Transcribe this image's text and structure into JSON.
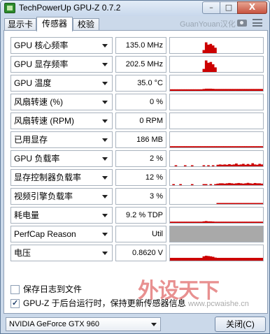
{
  "window": {
    "title": "TechPowerUp GPU-Z 0.7.2",
    "close_glyph": "X"
  },
  "tabs": [
    {
      "label": "显示卡"
    },
    {
      "label": "传感器",
      "active": true
    },
    {
      "label": "校验"
    }
  ],
  "brand_text": "GuanYouan汉化",
  "sensors": [
    {
      "label": "GPU 核心频率",
      "value": "135.0 MHz",
      "trace": [
        0,
        0,
        0,
        0,
        0,
        0,
        0,
        0,
        0,
        0,
        0,
        0,
        0,
        0,
        0.2,
        0.7,
        0.55,
        0.6,
        0.5,
        0.35,
        0,
        0,
        0,
        0,
        0,
        0,
        0,
        0,
        0,
        0,
        0,
        0,
        0,
        0,
        0,
        0,
        0,
        0,
        0,
        0
      ]
    },
    {
      "label": "GPU 显存频率",
      "value": "202.5 MHz",
      "trace": [
        0,
        0,
        0,
        0,
        0,
        0,
        0,
        0,
        0,
        0,
        0,
        0,
        0,
        0,
        0.2,
        0.75,
        0.6,
        0.65,
        0.5,
        0.3,
        0,
        0,
        0,
        0,
        0,
        0,
        0,
        0,
        0,
        0,
        0,
        0,
        0,
        0,
        0,
        0,
        0,
        0,
        0,
        0
      ]
    },
    {
      "label": "GPU 温度",
      "value": "35.0 °C",
      "trace": [
        0.1,
        0.1,
        0.1,
        0.1,
        0.1,
        0.1,
        0.1,
        0.1,
        0.1,
        0.1,
        0.1,
        0.1,
        0.1,
        0.1,
        0.12,
        0.14,
        0.14,
        0.14,
        0.13,
        0.12,
        0.12,
        0.12,
        0.12,
        0.12,
        0.12,
        0.12,
        0.12,
        0.12,
        0.12,
        0.12,
        0.12,
        0.12,
        0.12,
        0.12,
        0.12,
        0.12,
        0.12,
        0.12,
        0.12,
        0.12
      ]
    },
    {
      "label": "风扇转速 (%)",
      "value": "0 %",
      "trace": []
    },
    {
      "label": "风扇转速 (RPM)",
      "value": "0 RPM",
      "trace": []
    },
    {
      "label": "已用显存",
      "value": "186 MB",
      "trace": [
        0.08,
        0.08,
        0.08,
        0.08,
        0.08,
        0.08,
        0.08,
        0.08,
        0.08,
        0.08,
        0.08,
        0.08,
        0.08,
        0.08,
        0.08,
        0.08,
        0.08,
        0.08,
        0.08,
        0.08,
        0.08,
        0.08,
        0.08,
        0.08,
        0.08,
        0.08,
        0.08,
        0.08,
        0.08,
        0.08,
        0.08,
        0.08,
        0.08,
        0.08,
        0.08,
        0.08,
        0.08,
        0.08,
        0.08,
        0.08
      ]
    },
    {
      "label": "GPU 负载率",
      "value": "2 %",
      "trace": [
        0,
        0,
        0.05,
        0,
        0,
        0,
        0.04,
        0,
        0,
        0.05,
        0,
        0,
        0,
        0,
        0.05,
        0,
        0.04,
        0,
        0.05,
        0,
        0.1,
        0.12,
        0.1,
        0.12,
        0.1,
        0.14,
        0.1,
        0.12,
        0.18,
        0.1,
        0.12,
        0.16,
        0.1,
        0.15,
        0.1,
        0.2,
        0.12,
        0.1,
        0.16,
        0.12
      ]
    },
    {
      "label": "显存控制器负载率",
      "value": "12 %",
      "trace": [
        0,
        0.03,
        0,
        0,
        0.03,
        0,
        0,
        0,
        0,
        0.03,
        0,
        0,
        0,
        0,
        0.03,
        0.05,
        0,
        0.03,
        0,
        0.05,
        0.1,
        0.12,
        0.12,
        0.1,
        0.12,
        0.14,
        0.12,
        0.1,
        0.12,
        0.14,
        0.12,
        0.1,
        0.12,
        0.15,
        0.12,
        0.1,
        0.14,
        0.12,
        0.12,
        0.1
      ]
    },
    {
      "label": "视频引擎负载率",
      "value": "3 %",
      "trace": [
        0,
        0,
        0,
        0,
        0,
        0,
        0,
        0,
        0,
        0,
        0,
        0,
        0,
        0,
        0,
        0,
        0,
        0,
        0,
        0,
        0.06,
        0.06,
        0.06,
        0.06,
        0.06,
        0.06,
        0.06,
        0.06,
        0.06,
        0.06,
        0.06,
        0.06,
        0.06,
        0.06,
        0.06,
        0.06,
        0.06,
        0.06,
        0.06,
        0.06
      ]
    },
    {
      "label": "耗电量",
      "value": "9.2 % TDP",
      "trace": [
        0.08,
        0.08,
        0.08,
        0.08,
        0.08,
        0.08,
        0.08,
        0.08,
        0.08,
        0.08,
        0.08,
        0.08,
        0.08,
        0.08,
        0.1,
        0.12,
        0.1,
        0.1,
        0.09,
        0.08,
        0.08,
        0.08,
        0.08,
        0.08,
        0.08,
        0.08,
        0.08,
        0.08,
        0.08,
        0.08,
        0.08,
        0.08,
        0.08,
        0.08,
        0.08,
        0.08,
        0.08,
        0.08,
        0.08,
        0.08
      ]
    },
    {
      "label": "PerfCap Reason",
      "value": "Util",
      "trace": [],
      "grey": true
    },
    {
      "label": "电压",
      "value": "0.8620 V",
      "trace": [
        0.18,
        0.18,
        0.18,
        0.18,
        0.18,
        0.18,
        0.18,
        0.18,
        0.18,
        0.18,
        0.18,
        0.18,
        0.18,
        0.18,
        0.28,
        0.32,
        0.3,
        0.28,
        0.25,
        0.2,
        0.18,
        0.18,
        0.18,
        0.18,
        0.18,
        0.18,
        0.18,
        0.18,
        0.18,
        0.18,
        0.18,
        0.18,
        0.18,
        0.18,
        0.18,
        0.18,
        0.18,
        0.18,
        0.18,
        0.18
      ]
    }
  ],
  "options": {
    "log_to_file": {
      "label": "保存日志到文件",
      "checked": false
    },
    "continue_background": {
      "label": "GPU-Z 于后台运行时，保持更新传感器信息",
      "checked": true
    }
  },
  "watermark": {
    "title": "外设天下",
    "url": "www.pcwaishe.cn"
  },
  "footer": {
    "gpu_selected": "NVIDIA GeForce GTX 960",
    "close_label": "关闭(C)"
  },
  "colors": {
    "trace": "#cc0000",
    "grey_fill": "#a9a9a9"
  }
}
